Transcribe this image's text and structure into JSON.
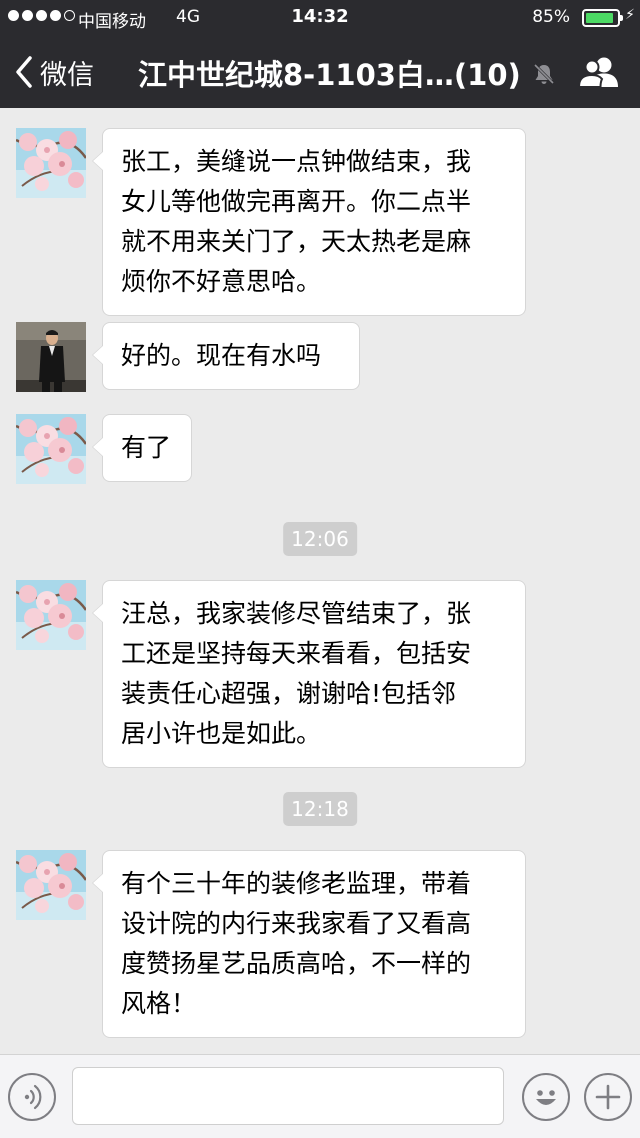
{
  "status_bar": {
    "carrier": "中国移动",
    "network": "4G",
    "time": "14:32",
    "battery_percent": "85%",
    "battery_level": 0.85,
    "battery_color": "#4cd964",
    "signal_bars_filled": 4,
    "signal_bars_total": 5
  },
  "nav": {
    "back_label": "微信",
    "title": "江中世纪城8-1103白…(10)",
    "icons": [
      "chevron-left-icon",
      "mute-bell-icon",
      "group-members-icon"
    ],
    "background": "#2b2b2f"
  },
  "chat": {
    "background": "#ebebeb",
    "messages": [
      {
        "avatar": "magnolia-avatar",
        "text": "张工，美缝说一点钟做结束，我\n女儿等他做完再离开。你二点半\n就不用来关门了，天太热老是麻\n烦你不好意思哈。"
      },
      {
        "avatar": "man-portrait-avatar",
        "text": "好的。现在有水吗"
      },
      {
        "avatar": "magnolia-avatar",
        "text": "有了"
      },
      {
        "avatar": "magnolia-avatar",
        "text": "汪总，我家装修尽管结束了，张\n工还是坚持每天来看看，包括安\n装责任心超强，谢谢哈!包括邻\n居小许也是如此。"
      },
      {
        "avatar": "magnolia-avatar",
        "text": "有个三十年的装修老监理，带着\n设计院的内行来我家看了又看高\n度赞扬星艺品质高哈，不一样的\n风格！"
      }
    ],
    "timestamps": [
      "12:06",
      "12:18"
    ]
  },
  "input_bar": {
    "icons": [
      "voice-icon",
      "emoji-icon",
      "plus-icon"
    ],
    "text_value": ""
  }
}
